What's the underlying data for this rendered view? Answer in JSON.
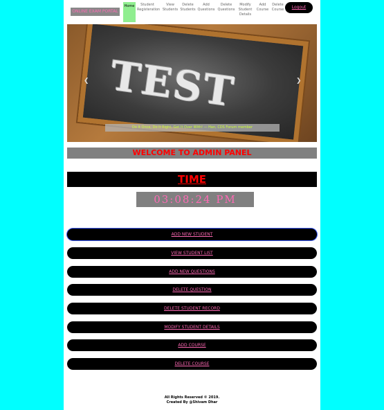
{
  "brand": "ONLINE EXAM PORTAL",
  "nav": [
    {
      "lines": [
        "Home"
      ],
      "active": true
    },
    {
      "lines": [
        "Student",
        "Registeration"
      ],
      "active": false
    },
    {
      "lines": [
        "View",
        "Students"
      ],
      "active": false
    },
    {
      "lines": [
        "Delete",
        "Students"
      ],
      "active": false
    },
    {
      "lines": [
        "Add",
        "Questions"
      ],
      "active": false
    },
    {
      "lines": [
        "Delete",
        "Questions"
      ],
      "active": false
    },
    {
      "lines": [
        "Modify",
        "Student",
        "Details"
      ],
      "active": false
    },
    {
      "lines": [
        "Add",
        "Course"
      ],
      "active": false
    },
    {
      "lines": [
        "Delete",
        "Course"
      ],
      "active": false
    }
  ],
  "logout": "Logout",
  "carousel": {
    "image_text": "TEST",
    "caption": "Do It Once, Do It Right, Get It Over With! — Han, CDS Forum member",
    "prev_icon": "chevron-left",
    "next_icon": "chevron-right"
  },
  "welcome": "WELCOME TO ADMIN PANEL",
  "time_title": "TIME",
  "clock": "03:08:24 PM",
  "actions": [
    "ADD NEW STUDENT",
    "VIEW STUDENT LIST",
    "ADD NEW QUESTIONS",
    "DELETE QUESTION",
    "DELETE STUDENT RECORD",
    "MODIFY STUDENT DETAILS",
    "ADD COURSE",
    "DELETE COURSE"
  ],
  "footer": {
    "line1": "All Rights Reserved © 2019.",
    "line2": "Created By @Shivam Dhar"
  },
  "colors": {
    "background": "#00ffff",
    "accent_pink": "#ff69b4",
    "title_red": "#ff0000",
    "active_nav": "#90ee90"
  }
}
